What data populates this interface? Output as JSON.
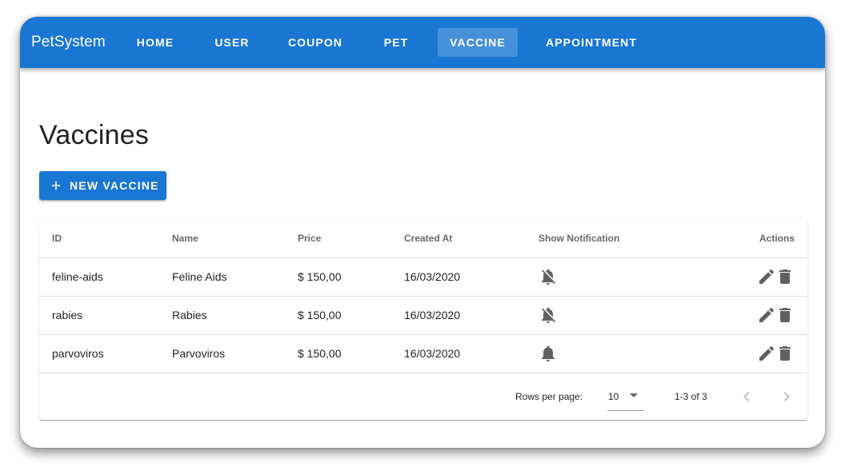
{
  "app": {
    "brand": "PetSystem",
    "nav": [
      {
        "label": "HOME",
        "active": false
      },
      {
        "label": "USER",
        "active": false
      },
      {
        "label": "COUPON",
        "active": false
      },
      {
        "label": "PET",
        "active": false
      },
      {
        "label": "VACCINE",
        "active": true
      },
      {
        "label": "APPOINTMENT",
        "active": false
      }
    ],
    "accent_color": "#1976d2"
  },
  "page": {
    "title": "Vaccines",
    "new_button_label": "NEW VACCINE",
    "new_button_icon": "plus-icon"
  },
  "table": {
    "columns": [
      "ID",
      "Name",
      "Price",
      "Created At",
      "Show Notification",
      "Actions"
    ],
    "rows": [
      {
        "id": "feline-aids",
        "name": "Feline Aids",
        "price": "$ 150,00",
        "created_at": "16/03/2020",
        "notification_icon": "bell-off-icon"
      },
      {
        "id": "rabies",
        "name": "Rabies",
        "price": "$ 150,00",
        "created_at": "16/03/2020",
        "notification_icon": "bell-off-icon"
      },
      {
        "id": "parvoviros",
        "name": "Parvoviros",
        "price": "$ 150,00",
        "created_at": "16/03/2020",
        "notification_icon": "bell-icon"
      }
    ],
    "action_icons": [
      "edit-icon",
      "delete-icon"
    ]
  },
  "pagination": {
    "rows_per_page_label": "Rows per page:",
    "rows_per_page_value": "10",
    "page_info": "1-3 of 3",
    "prev_icon": "chevron-left-icon",
    "next_icon": "chevron-right-icon"
  }
}
